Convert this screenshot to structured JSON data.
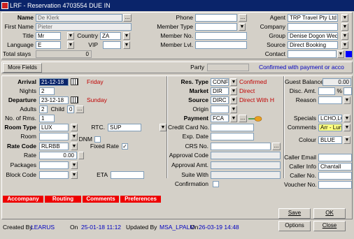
{
  "window": {
    "title": "LRF - Reservation 4703554  DUE IN"
  },
  "profile": {
    "name_label": "Name",
    "name": "De Klerk",
    "first_name_label": "First Name",
    "first_name": "Pieter",
    "title_label": "Title",
    "title": "Mr",
    "country_label": "Country",
    "country": "ZA",
    "language_label": "Language",
    "language": "E",
    "vip_label": "VIP",
    "vip": "",
    "total_stays_label": "Total stays",
    "total_stays": "0",
    "phone_label": "Phone",
    "phone": "",
    "member_type_label": "Member Type",
    "member_type": "",
    "member_no_label": "Member No.",
    "member_no": "",
    "member_lvl_label": "Member Lvl.",
    "member_lvl": "",
    "agent_label": "Agent",
    "agent": "TRP Travel Pty Ltd",
    "company_label": "Company",
    "company": "",
    "group_label": "Group",
    "group": "Denise Dogon Wedd",
    "source_label": "Source",
    "source": "Direct Booking",
    "contact_label": "Contact",
    "contact": ""
  },
  "party_bar": {
    "more_fields": "More Fields",
    "party_label": "Party",
    "party": "",
    "status": "Confirmed with payment or acco"
  },
  "stay": {
    "arrival_label": "Arrival",
    "arrival": "21-12-18",
    "arrival_day": "Friday",
    "nights_label": "Nights",
    "nights": "2",
    "departure_label": "Departure",
    "departure": "23-12-18",
    "departure_day": "Sunday",
    "adults_label": "Adults",
    "adults": "2",
    "child_label": "Child",
    "child": "0",
    "rooms_label": "No. of Rms.",
    "rooms": "1",
    "room_type_label": "Room Type",
    "room_type": "LUX",
    "rtc_label": "RTC.",
    "rtc": "SUP",
    "room_label": "Room",
    "room": "",
    "dnm_label": "DNM",
    "rate_code_label": "Rate Code",
    "rate_code": "RLRBB",
    "fixed_rate_label": "Fixed Rate",
    "fixed_rate_check": "✓",
    "rate_label": "Rate",
    "rate": "0.00",
    "packages_label": "Packages",
    "packages": "",
    "block_code_label": "Block Code",
    "block_code": "",
    "eta_label": "ETA",
    "eta": ""
  },
  "reservation": {
    "res_type_label": "Res. Type",
    "res_type": "CONF",
    "res_type_desc": "Confirmed",
    "market_label": "Market",
    "market": "DIR",
    "market_desc": "Direct",
    "source_label": "Source",
    "source": "DIRC",
    "source_desc": "Direct With H",
    "origin_label": "Origin",
    "origin": "",
    "payment_label": "Payment",
    "payment": "FCA",
    "credit_card_label": "Credit Card No.",
    "credit_card": "",
    "exp_date_label": "Exp. Date",
    "exp_date": "",
    "crs_no_label": "CRS No.",
    "crs_no": "",
    "approval_code_label": "Approval Code",
    "approval_code": "",
    "approval_amt_label": "Approval Amt.",
    "approval_amt": "",
    "suite_with_label": "Suite With",
    "suite_with": "",
    "confirmation_label": "Confirmation"
  },
  "extras": {
    "guest_balance_label": "Guest Balance",
    "guest_balance": "0.00",
    "disc_amt_label": "Disc. Amt.",
    "disc_amt": "",
    "disc_pct": "",
    "pct_sign": "%",
    "reason_label": "Reason",
    "reason": "",
    "specials_label": "Specials",
    "specials": "LCHO,LOFL",
    "comments_label": "Comments",
    "comments": "Arr - Lunch on Arri",
    "colour_label": "Colour",
    "colour": "BLUE",
    "caller_email_label": "Caller Email",
    "caller_email": "",
    "caller_info_label": "Caller Info",
    "caller_info": "Chantall",
    "caller_no_label": "Caller No.",
    "caller_no": "",
    "voucher_no_label": "Voucher No.",
    "voucher_no": ""
  },
  "tabs": [
    "Accompany",
    "Routing",
    "Comments",
    "Preferences"
  ],
  "footer": {
    "created_by_label": "Created By",
    "created_by": "LEARUS",
    "on_label": "On",
    "created_on": "25-01-18 11:12",
    "updated_by_label": "Updated By",
    "updated_by": "MSA_LPALM",
    "updated_on": "26-03-19 14:48",
    "save": "Save",
    "ok": "OK",
    "options": "Options",
    "close": "Close"
  },
  "colors": {
    "title_bar": "#0a246a",
    "red_text": "#c00000",
    "blue_text": "#0000c0",
    "tab_red": "#e00000",
    "highlight_yellow": "#ffff80"
  }
}
